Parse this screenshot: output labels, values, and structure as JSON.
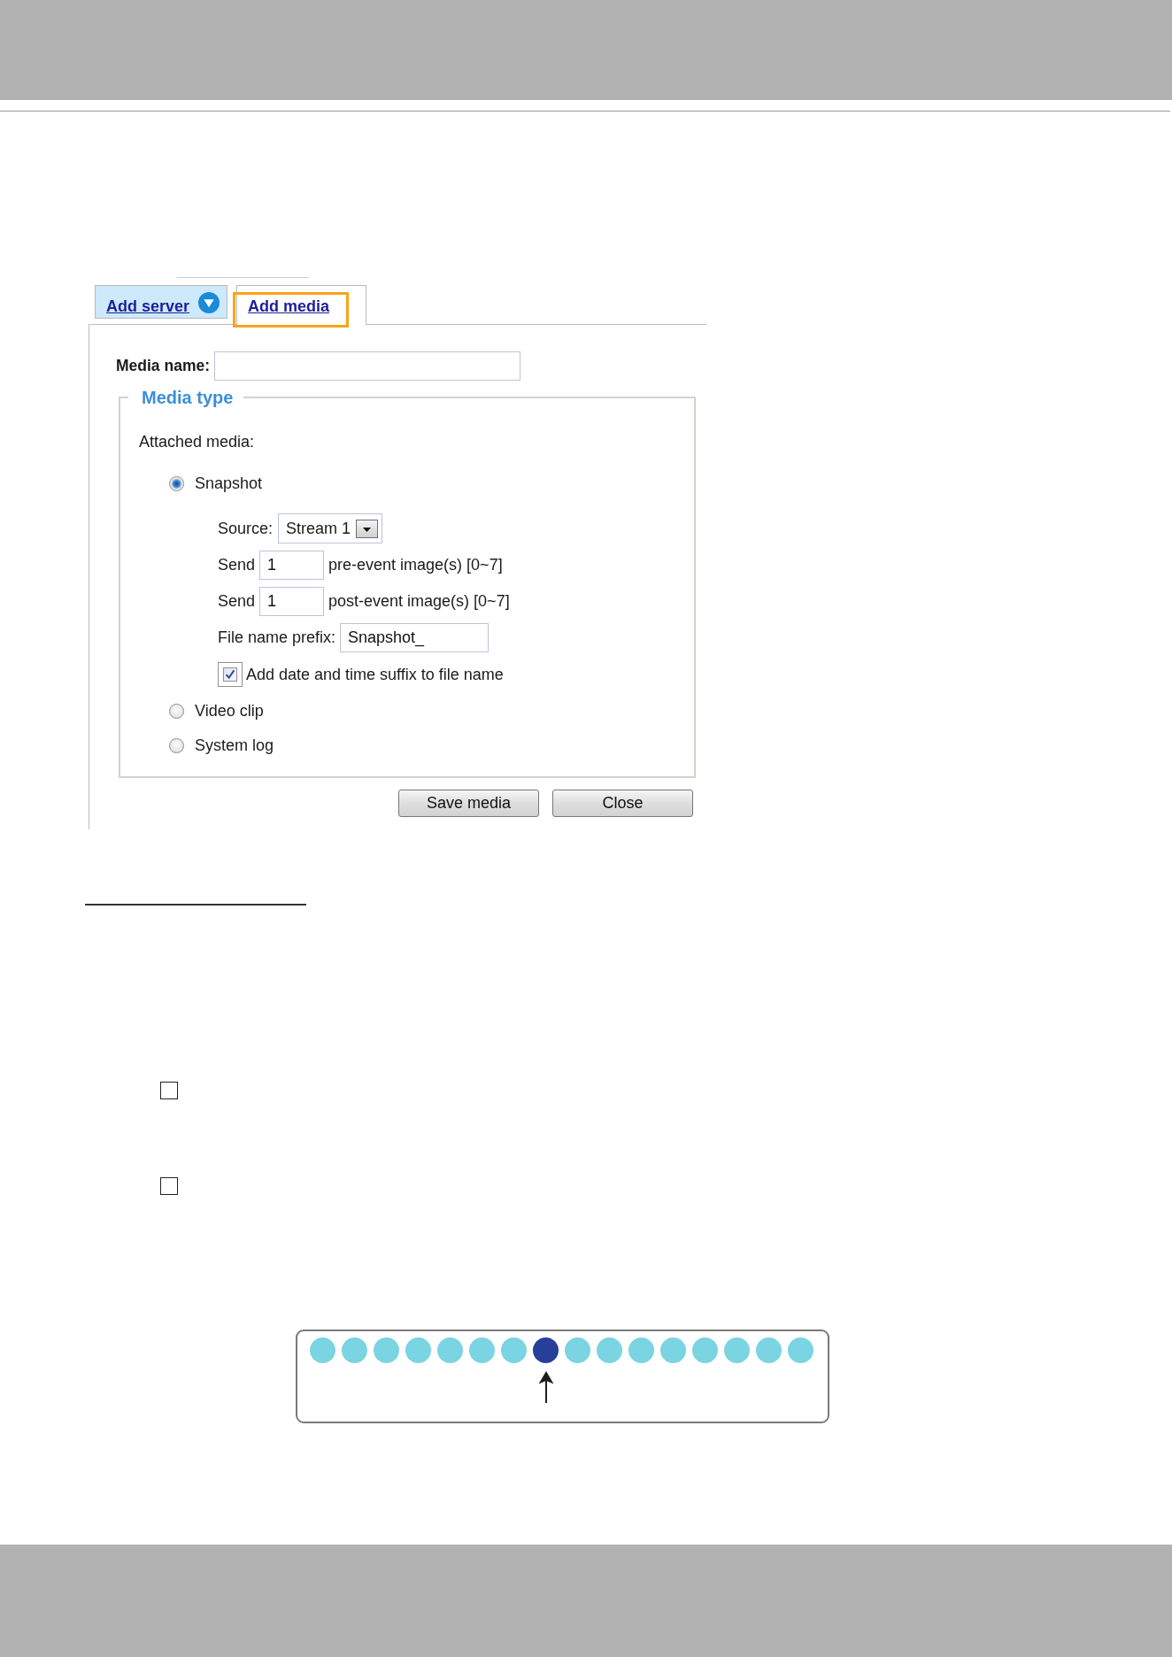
{
  "tabs": [
    {
      "label": "Add server",
      "selected": false,
      "expandable": true,
      "highlighted": false
    },
    {
      "label": "Add media",
      "selected": true,
      "expandable": false,
      "highlighted": true
    }
  ],
  "media_name": {
    "label": "Media name:"
  },
  "media_type": {
    "legend": "Media type",
    "prompt": "Attached media:",
    "options": [
      {
        "label": "Snapshot",
        "selected": true,
        "settings": {
          "source": {
            "label": "Source:",
            "value": "Stream 1"
          },
          "pre_event": {
            "label": "Send",
            "value": "1",
            "suffix": "pre-event image(s) [0~7]"
          },
          "post_event": {
            "label": "Send",
            "value": "1",
            "suffix": "post-event image(s) [0~7]"
          },
          "file_name_prefix": {
            "label": "File name prefix:",
            "value": "Snapshot_"
          },
          "date_time_suffix": {
            "label": "Add date and time suffix to file name",
            "checked": true,
            "focused": true
          }
        }
      },
      {
        "label": "Video clip",
        "selected": false
      },
      {
        "label": "System log",
        "selected": false
      }
    ]
  },
  "buttons": [
    "Save media",
    "Close"
  ],
  "page_checkboxes": [
    {
      "checked": false
    },
    {
      "checked": false
    }
  ],
  "position_diagram": {
    "dots": [
      {
        "kind": "plain",
        "color": "#7ad4e2"
      },
      {
        "kind": "plain",
        "color": "#7ad4e2"
      },
      {
        "kind": "plain",
        "color": "#7ad4e2"
      },
      {
        "kind": "plain",
        "color": "#7ad4e2"
      },
      {
        "kind": "plain",
        "color": "#7ad4e2"
      },
      {
        "kind": "plain",
        "color": "#7ad4e2"
      },
      {
        "kind": "plain",
        "color": "#7ad4e2"
      },
      {
        "kind": "pointed",
        "color": "#283f9a"
      },
      {
        "kind": "plain",
        "color": "#7ad4e2"
      },
      {
        "kind": "plain",
        "color": "#7ad4e2"
      },
      {
        "kind": "plain",
        "color": "#7ad4e2"
      },
      {
        "kind": "plain",
        "color": "#7ad4e2"
      },
      {
        "kind": "plain",
        "color": "#7ad4e2"
      },
      {
        "kind": "plain",
        "color": "#7ad4e2"
      },
      {
        "kind": "plain",
        "color": "#7ad4e2"
      },
      {
        "kind": "plain",
        "color": "#7ad4e2"
      }
    ]
  }
}
